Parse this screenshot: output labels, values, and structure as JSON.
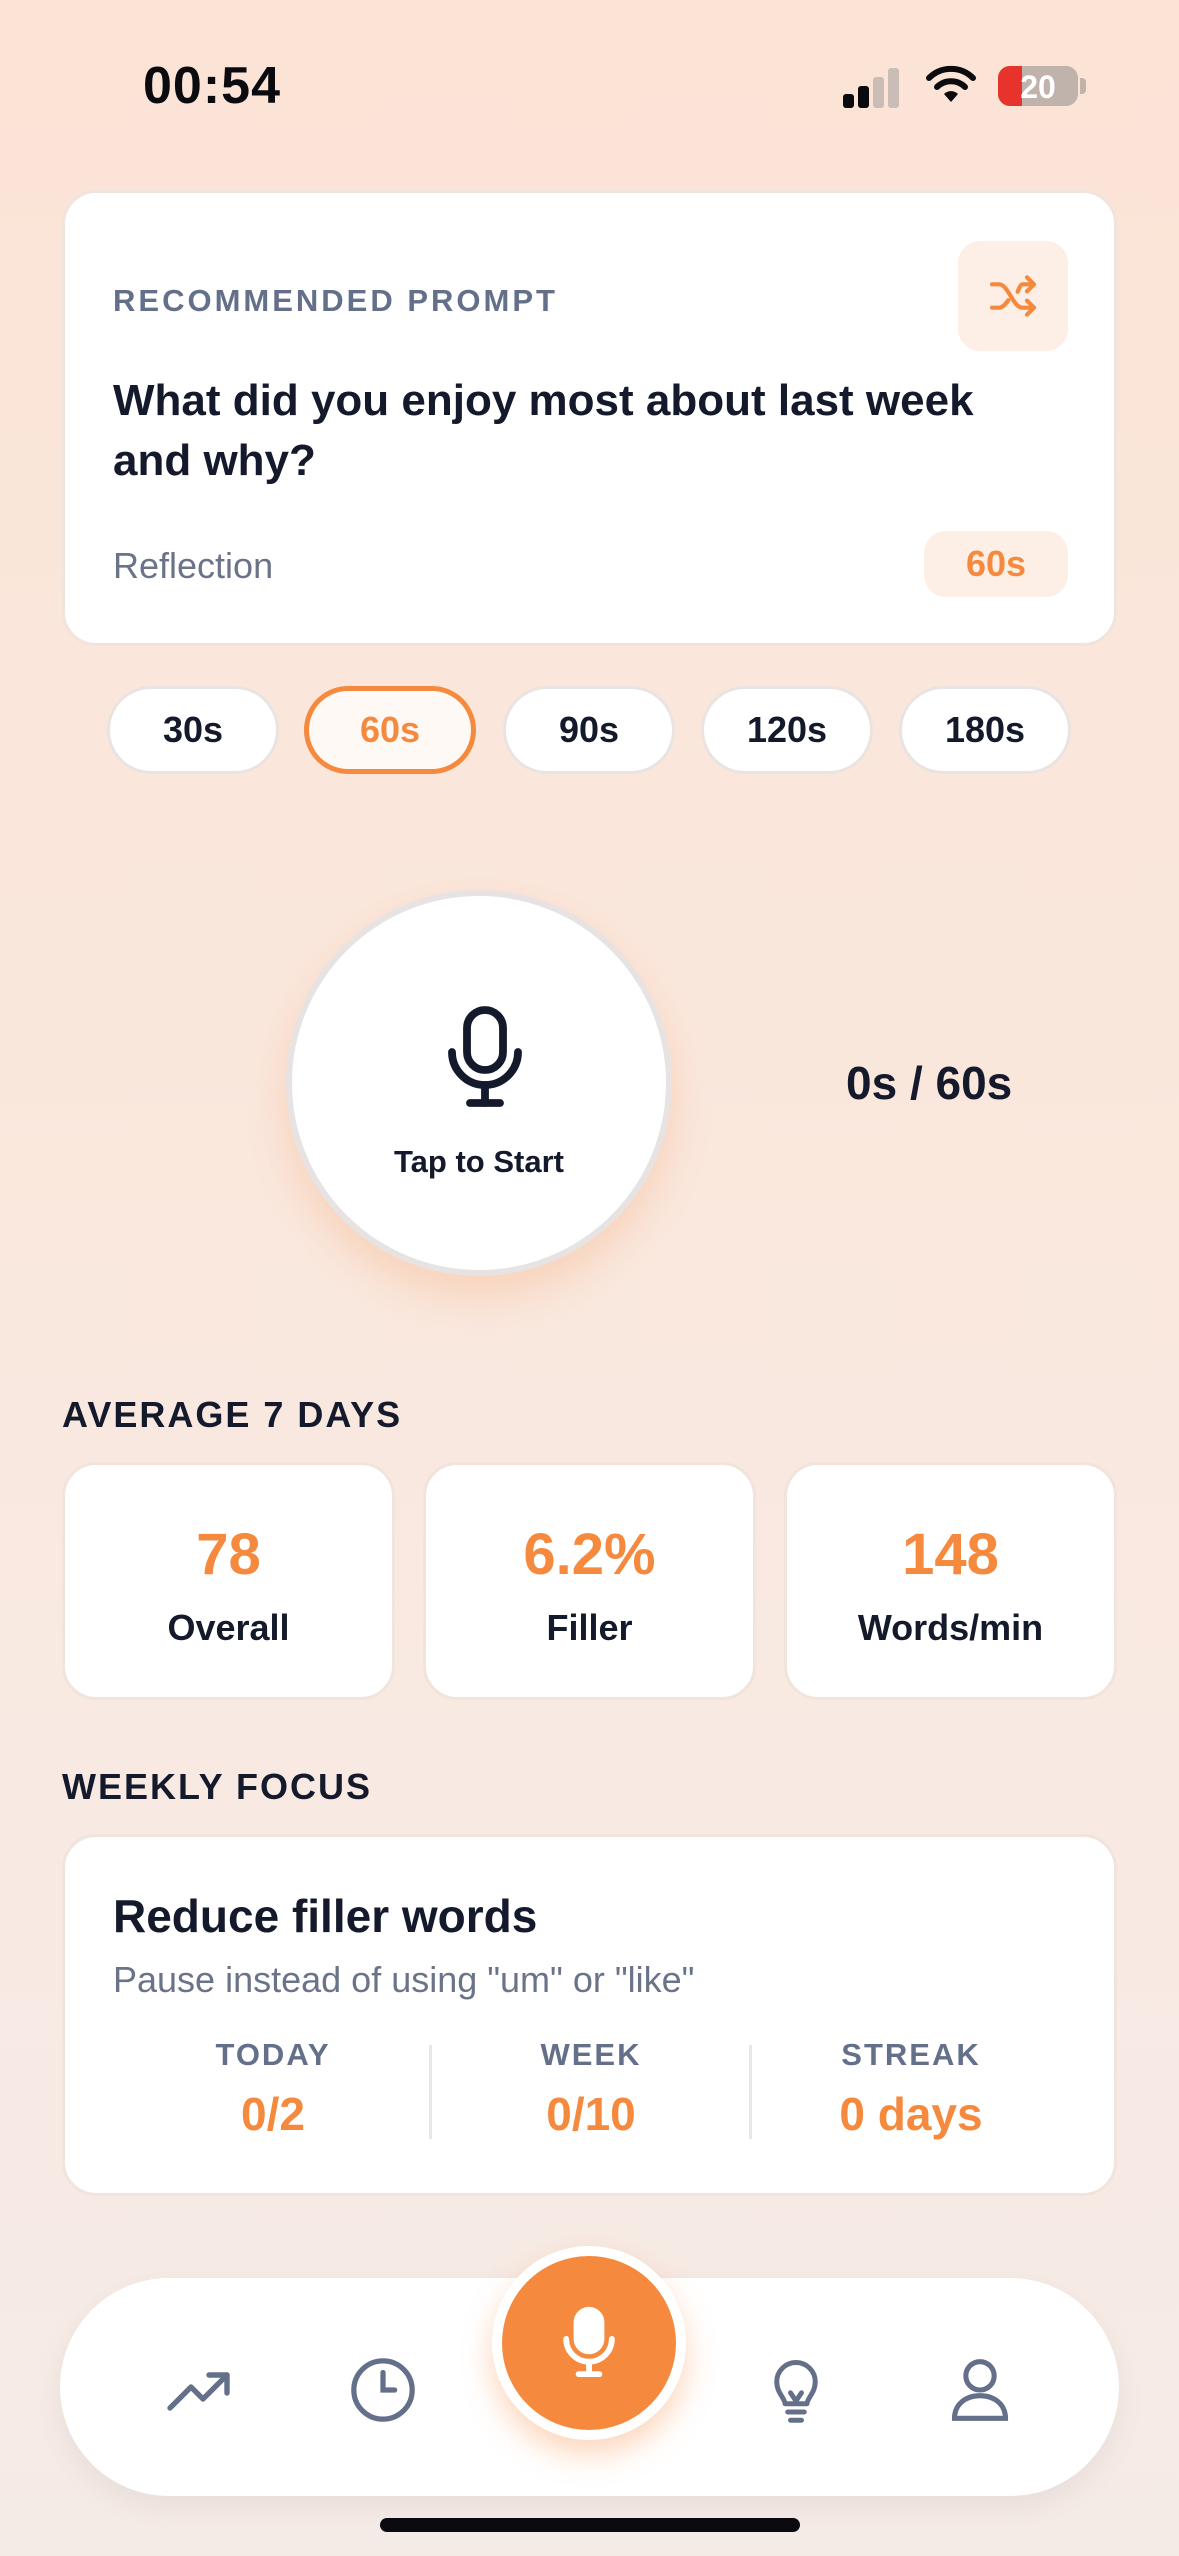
{
  "status_bar": {
    "time": "00:54",
    "battery": "20"
  },
  "prompt_card": {
    "label": "RECOMMENDED PROMPT",
    "text": "What did you enjoy most about last week and why?",
    "category": "Reflection",
    "duration": "60s"
  },
  "durations": [
    {
      "label": "30s",
      "selected": false
    },
    {
      "label": "60s",
      "selected": true
    },
    {
      "label": "90s",
      "selected": false
    },
    {
      "label": "120s",
      "selected": false
    },
    {
      "label": "180s",
      "selected": false
    }
  ],
  "recorder": {
    "tap_label": "Tap to Start",
    "timer": "0s / 60s"
  },
  "averages": {
    "title": "AVERAGE 7 DAYS",
    "stats": [
      {
        "value": "78",
        "label": "Overall"
      },
      {
        "value": "6.2%",
        "label": "Filler"
      },
      {
        "value": "148",
        "label": "Words/min"
      }
    ]
  },
  "weekly_focus": {
    "title": "WEEKLY FOCUS",
    "card_title": "Reduce filler words",
    "subtitle": "Pause instead of using \"um\" or \"like\"",
    "metrics": [
      {
        "label": "TODAY",
        "value": "0/2"
      },
      {
        "label": "WEEK",
        "value": "0/10"
      },
      {
        "label": "STREAK",
        "value": "0 days"
      }
    ]
  },
  "tab_bar": {
    "icons": [
      "trending-up-icon",
      "clock-icon",
      "microphone-icon",
      "lightbulb-icon",
      "profile-icon"
    ]
  },
  "colors": {
    "accent": "#f58a3e",
    "text": "#141a2b",
    "muted": "#64708a"
  }
}
